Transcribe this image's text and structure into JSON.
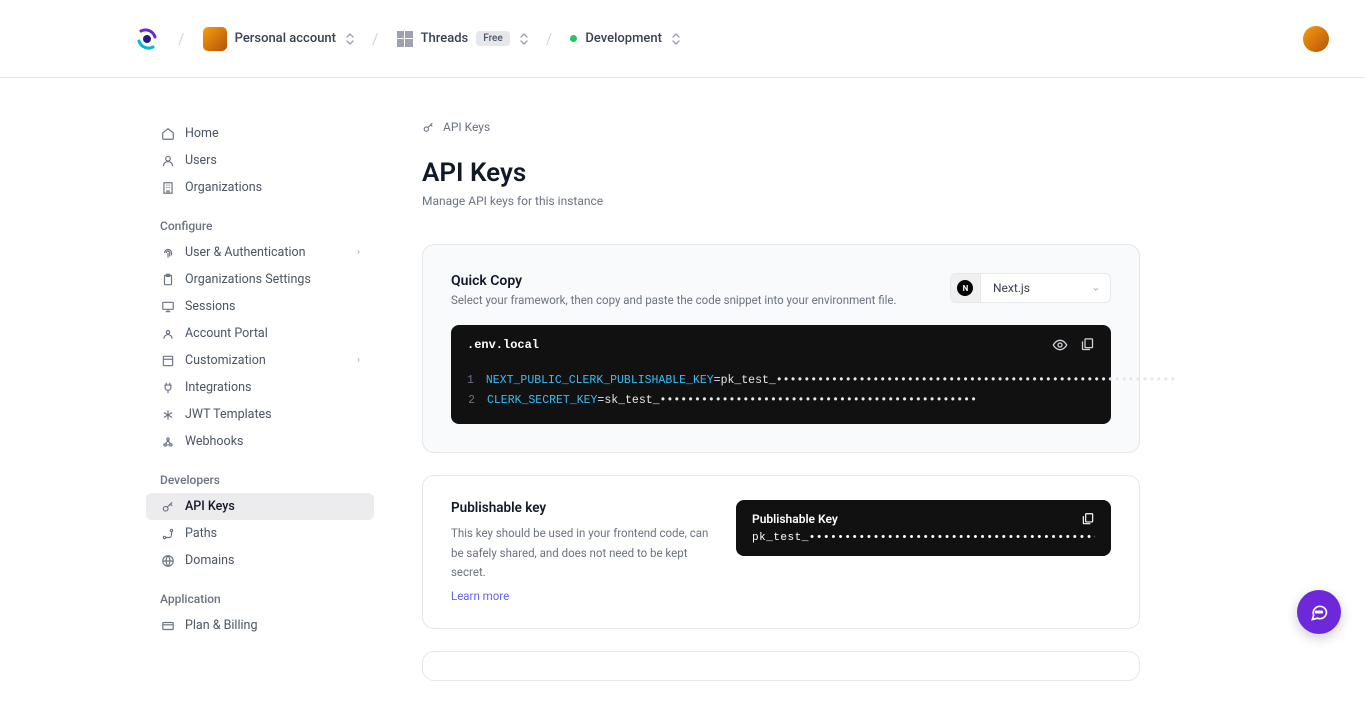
{
  "header": {
    "workspace": "Personal account",
    "project": "Threads",
    "plan_badge": "Free",
    "environment": "Development"
  },
  "breadcrumb": {
    "label": "API Keys"
  },
  "page": {
    "title": "API Keys",
    "subtitle": "Manage API keys for this instance"
  },
  "sidebar": {
    "top": [
      {
        "label": "Home"
      },
      {
        "label": "Users"
      },
      {
        "label": "Organizations"
      }
    ],
    "configure_heading": "Configure",
    "configure": [
      {
        "label": "User & Authentication",
        "chevron": true
      },
      {
        "label": "Organizations Settings"
      },
      {
        "label": "Sessions"
      },
      {
        "label": "Account Portal"
      },
      {
        "label": "Customization",
        "chevron": true
      },
      {
        "label": "Integrations"
      },
      {
        "label": "JWT Templates"
      },
      {
        "label": "Webhooks"
      }
    ],
    "developers_heading": "Developers",
    "developers": [
      {
        "label": "API Keys",
        "active": true
      },
      {
        "label": "Paths"
      },
      {
        "label": "Domains"
      }
    ],
    "application_heading": "Application",
    "application": [
      {
        "label": "Plan & Billing"
      }
    ]
  },
  "quick_copy": {
    "title": "Quick Copy",
    "subtitle": "Select your framework, then copy and paste the code snippet into your environment file.",
    "framework": "Next.js",
    "filename": ".env.local",
    "lines": [
      {
        "n": "1",
        "key": "NEXT_PUBLIC_CLERK_PUBLISHABLE_KEY",
        "eq": "=",
        "val": "pk_test_••••••••••••••••••••••••••••••••••••••••••••••••••••••••••"
      },
      {
        "n": "2",
        "key": "CLERK_SECRET_KEY",
        "eq": "=",
        "val": "sk_test_••••••••••••••••••••••••••••••••••••••••••••••"
      }
    ]
  },
  "publishable": {
    "title": "Publishable key",
    "desc": "This key should be used in your frontend code, can be safely shared, and does not need to be kept secret.",
    "learn": "Learn more",
    "card_title": "Publishable Key",
    "card_value": "pk_test_•••••••••••••••••••••••••••••••••••••••••••••••••••••••••"
  }
}
